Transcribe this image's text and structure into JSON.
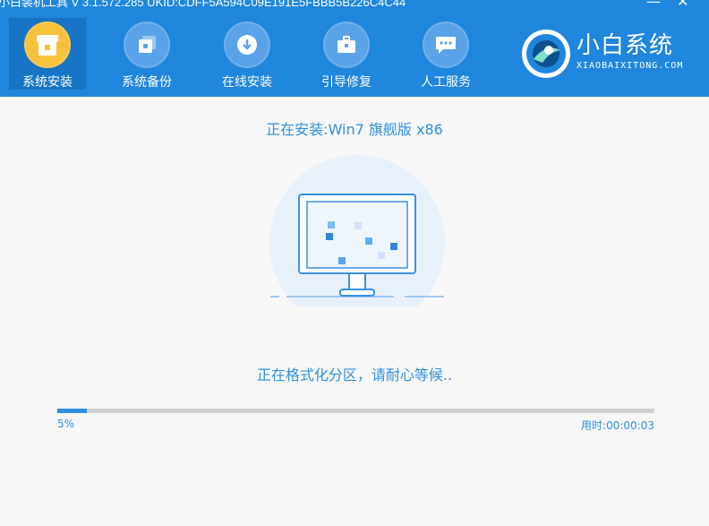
{
  "window": {
    "title": "小白装机工具 V 3.1.572.285 UKID:CDFF5A594C09E191E5FBBB5B226C4C44",
    "minimize_icon": "minimize-icon",
    "close_icon": "close-icon"
  },
  "nav": {
    "items": [
      {
        "label": "系统安装",
        "icon": "install-box-icon",
        "active": true
      },
      {
        "label": "系统备份",
        "icon": "backup-icon",
        "active": false
      },
      {
        "label": "在线安装",
        "icon": "download-icon",
        "active": false
      },
      {
        "label": "引导修复",
        "icon": "toolbox-icon",
        "active": false
      },
      {
        "label": "人工服务",
        "icon": "chat-icon",
        "active": false
      }
    ]
  },
  "brand": {
    "name": "小白系统",
    "url": "XIAOBAIXITONG.COM"
  },
  "install": {
    "title": "正在安装:Win7 旗舰版 x86",
    "status": "正在格式化分区，请耐心等候..",
    "progress_label": "5%",
    "progress_fraction": 0.05,
    "elapsed_label": "用时:00:00:03"
  },
  "colors": {
    "header": "#1f86dd",
    "accent": "#2f8fe0",
    "active_icon": "#f5c23a"
  }
}
